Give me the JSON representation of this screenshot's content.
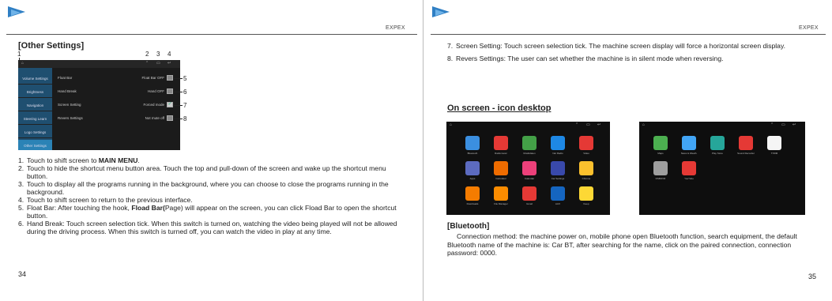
{
  "left_page": {
    "brand": "EXPEX",
    "section_title": "[Other Settings]",
    "callout_numbers": [
      "1",
      "2",
      "3",
      "4",
      "5",
      "6",
      "7",
      "8"
    ],
    "screenshot": {
      "sidebar": [
        "Volume Settings",
        "Brightness",
        "Navigation",
        "Steering Learn",
        "Logo Settings",
        "Other Settings"
      ],
      "rows": [
        {
          "label": "Float Bar",
          "value": "Float Bar OFF"
        },
        {
          "label": "Hand Break",
          "value": "Hand OFF"
        },
        {
          "label": "Screen Setting",
          "value": "Forced mode"
        },
        {
          "label": "Revers Settings",
          "value": "Not mute off"
        }
      ]
    },
    "items": [
      {
        "n": "1.",
        "segments": [
          {
            "t": "Touch to shift screen to "
          },
          {
            "t": "MAIN MENU",
            "b": true
          },
          {
            "t": "."
          }
        ]
      },
      {
        "n": "2.",
        "segments": [
          {
            "t": "Touch to hide the shortcut menu button area. Touch the top and pull-down of the screen and wake up the shortcut menu button."
          }
        ]
      },
      {
        "n": "3.",
        "segments": [
          {
            "t": "Touch to display all the programs running in the background, where you can choose to close the programs running in the background."
          }
        ]
      },
      {
        "n": "4.",
        "segments": [
          {
            "t": "Touch to shift screen to return to the previous interface."
          }
        ]
      },
      {
        "n": "5.",
        "segments": [
          {
            "t": "Float Bar: After touching the hook, "
          },
          {
            "t": "Fload Bar(",
            "b": true
          },
          {
            "t": "Page) will appear on the screen, you can click Fload Bar to open the shortcut button."
          }
        ]
      },
      {
        "n": "6.",
        "segments": [
          {
            "t": "Hand Break: Touch screen selection tick.  When this switch is turned on, watching the video being played will not be allowed during the driving process. When this switch is turned off, you can watch the video in play at any time."
          }
        ]
      }
    ],
    "page_number": "34"
  },
  "right_page": {
    "brand": "EXPEX",
    "items": [
      {
        "n": "7.",
        "text": "Screen Setting: Touch screen selection tick.  The machine screen display will force a horizontal screen display."
      },
      {
        "n": "8.",
        "text": "Revers Settings: The user can set whether the machine is in silent mode when reversing."
      }
    ],
    "icon_title": "On screen - icon desktop",
    "desktop1_apps": [
      {
        "label": "Bluetooth",
        "color": "#3b8fe0"
      },
      {
        "label": "Radiomusic",
        "color": "#e53935"
      },
      {
        "label": "Musikdaten",
        "color": "#43a047"
      },
      {
        "label": "Net Radio",
        "color": "#1e88e5"
      },
      {
        "label": "Video",
        "color": "#e53935"
      },
      {
        "label": "Apps",
        "color": "#5c6bc0"
      },
      {
        "label": "Calculator",
        "color": "#ef6c00"
      },
      {
        "label": "Calendar",
        "color": "#ec407a"
      },
      {
        "label": "Car Settings",
        "color": "#3949ab"
      },
      {
        "label": "Chrome",
        "color": "#fbc02d"
      },
      {
        "label": "Downloads",
        "color": "#f57c00"
      },
      {
        "label": "File Manager",
        "color": "#fb8c00"
      },
      {
        "label": "Gmail",
        "color": "#e53935"
      },
      {
        "label": "AUX",
        "color": "#1565c0"
      },
      {
        "label": "Keep",
        "color": "#fdd835"
      }
    ],
    "desktop2_apps": [
      {
        "label": "Maps",
        "color": "#4caf50"
      },
      {
        "label": "News & Weath.",
        "color": "#42a5f5"
      },
      {
        "label": "Play Store",
        "color": "#26a69a"
      },
      {
        "label": "Sound Recorder",
        "color": "#e53935"
      },
      {
        "label": "TXRM",
        "color": "#f5f5f5"
      },
      {
        "label": "DSBOVR",
        "color": "#9e9e9e"
      },
      {
        "label": "YouTube",
        "color": "#e53935"
      }
    ],
    "bt_title": "[Bluetooth]",
    "bt_text": "Connection method: the machine power on, mobile phone open Bluetooth function, search equipment, the default Bluetooth name of the machine is: Car BT, after searching for the name, click on the paired connection, connection password: 0000.",
    "page_number": "35"
  },
  "colors": {
    "accent_logo": "#2f7fc4",
    "screen_bg": "#1b1b1b"
  }
}
